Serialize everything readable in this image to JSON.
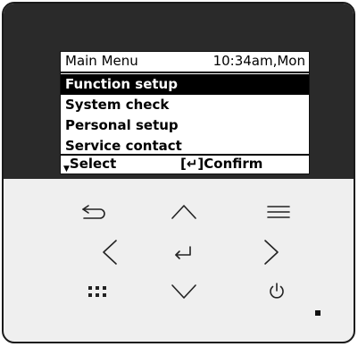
{
  "screen": {
    "title": "Main Menu",
    "clock": "10:34am,Mon",
    "menu_items": [
      "Function setup",
      "System check",
      "Personal setup",
      "Service contact"
    ],
    "selected_index": 0,
    "footer_select": "Select",
    "footer_confirm": "[↵]Confirm"
  },
  "buttons": [
    "back",
    "up",
    "menu",
    "left",
    "enter",
    "right",
    "grid",
    "down",
    "power"
  ],
  "icons": {
    "back": "back-arrow-icon",
    "up": "chevron-up-icon",
    "menu": "hamburger-menu-icon",
    "left": "chevron-left-icon",
    "enter": "enter-return-icon",
    "right": "chevron-right-icon",
    "grid": "grid-dots-icon",
    "down": "chevron-down-icon",
    "power": "power-icon"
  },
  "colors": {
    "bezel": "#2a2a2a",
    "panel": "#efefef",
    "screen": "#ffffff",
    "selection": "#000000"
  }
}
